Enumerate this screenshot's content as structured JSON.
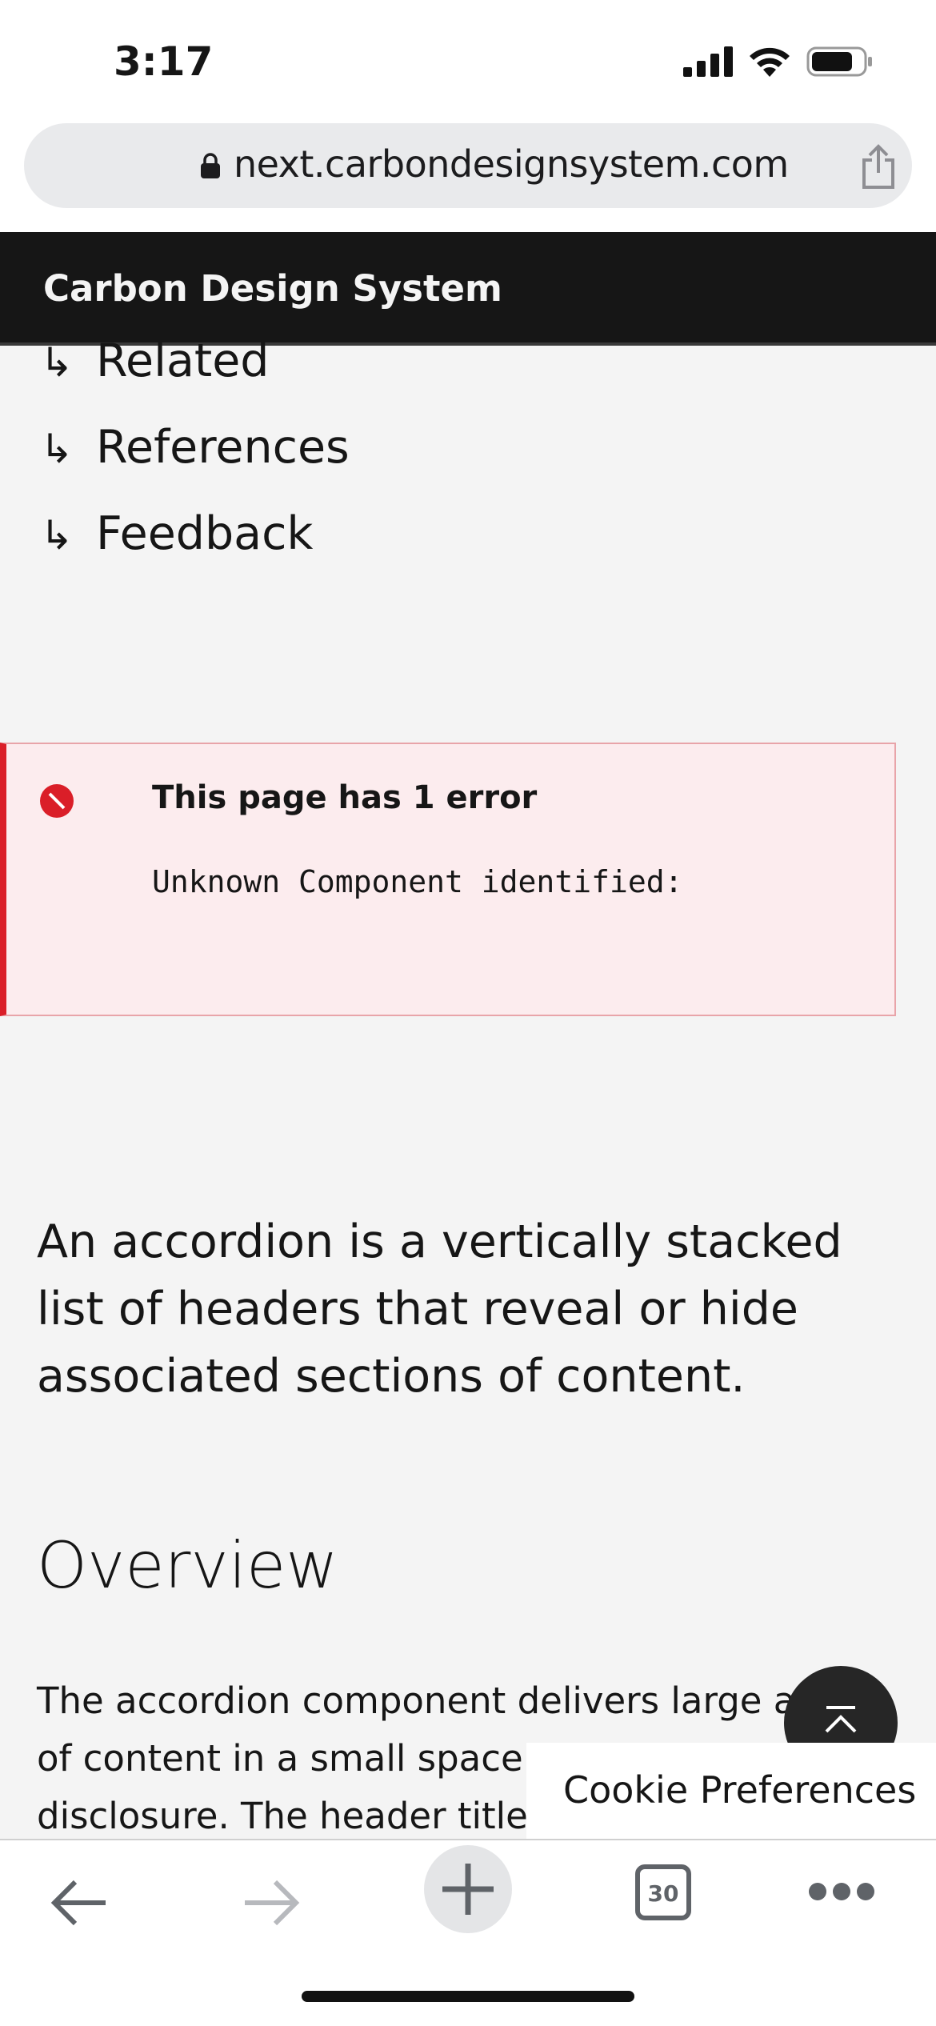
{
  "status_bar": {
    "time": "3:17"
  },
  "browser": {
    "url": "next.carbondesignsystem.com",
    "tab_count": "30"
  },
  "header": {
    "title": "Carbon Design System"
  },
  "anchors": [
    {
      "arrow": "↳",
      "label": "Related"
    },
    {
      "arrow": "↳",
      "label": "References"
    },
    {
      "arrow": "↳",
      "label": "Feedback"
    }
  ],
  "error": {
    "title": "This page has 1 error",
    "message": "Unknown Component identified: "
  },
  "content": {
    "intro": "An accordion is a vertically stacked list of headers that reveal or hide associated sections of content.",
    "heading": "Overview",
    "paragraph_lines": [
      "The accordion component delivers large am",
      "of content in a small space th",
      "disclosure. The header title g"
    ]
  },
  "cookie": {
    "label": "Cookie Preferences"
  },
  "colors": {
    "header_bg": "#161616",
    "error_accent": "#da1e28",
    "error_bg": "#fcecee",
    "page_bg": "#f4f4f4"
  },
  "icons": [
    "lock-icon",
    "share-icon",
    "error-icon",
    "back-to-top-icon",
    "back-arrow-icon",
    "forward-arrow-icon",
    "plus-icon",
    "tabs-icon",
    "more-icon"
  ]
}
